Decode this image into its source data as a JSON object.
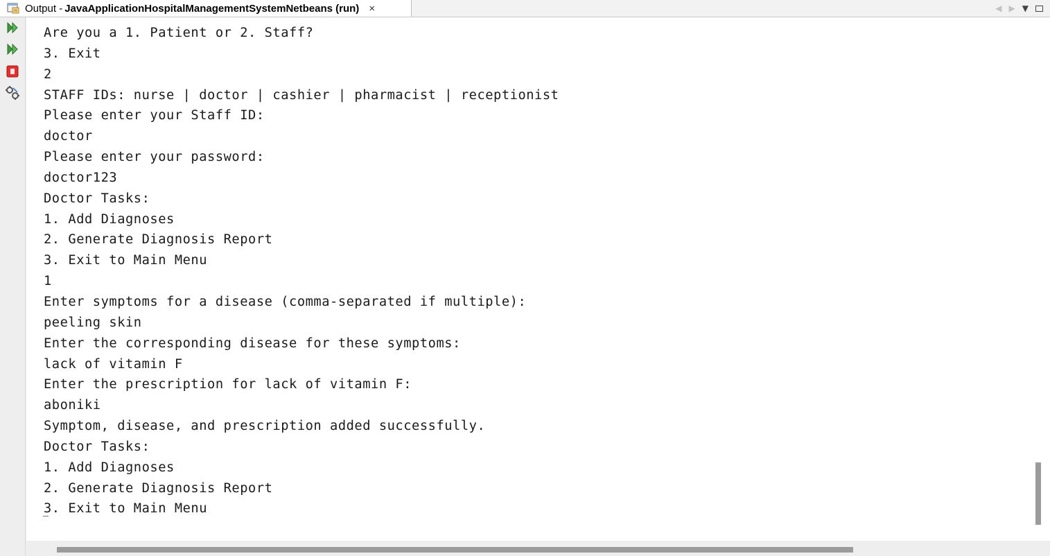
{
  "tab": {
    "prefix": "Output -",
    "title": "JavaApplicationHospitalManagementSystemNetbeans (run)",
    "close_glyph": "×",
    "icon": "output-window-icon"
  },
  "tab_nav": {
    "prev_glyph": "◀",
    "next_glyph": "▶",
    "dropdown_glyph": "▼"
  },
  "toolbar": {
    "buttons": [
      {
        "name": "rerun-icon",
        "color": "#3c9a3c"
      },
      {
        "name": "rerun-with-params-icon",
        "color": "#3c9a3c"
      },
      {
        "name": "stop-icon",
        "color": "#e03030"
      },
      {
        "name": "settings-icon",
        "color": "#555555"
      }
    ]
  },
  "console": {
    "lines": [
      "Are you a 1. Patient or 2. Staff?",
      "3. Exit",
      "2",
      "STAFF IDs: nurse | doctor | cashier | pharmacist | receptionist",
      "Please enter your Staff ID:",
      "doctor",
      "Please enter your password:",
      "doctor123",
      "Doctor Tasks:",
      "1. Add Diagnoses",
      "2. Generate Diagnosis Report",
      "3. Exit to Main Menu",
      "1",
      "Enter symptoms for a disease (comma-separated if multiple):",
      "peeling skin",
      "Enter the corresponding disease for these symptoms:",
      "lack of vitamin F",
      "Enter the prescription for lack of vitamin F:",
      "aboniki",
      "Symptom, disease, and prescription added successfully.",
      "Doctor Tasks:",
      "1. Add Diagnoses",
      "2. Generate Diagnosis Report",
      "3. Exit to Main Menu"
    ]
  },
  "colors": {
    "console_text": "#1a1a1a",
    "scroll_thumb": "#9b9b9b",
    "background": "#ffffff"
  }
}
